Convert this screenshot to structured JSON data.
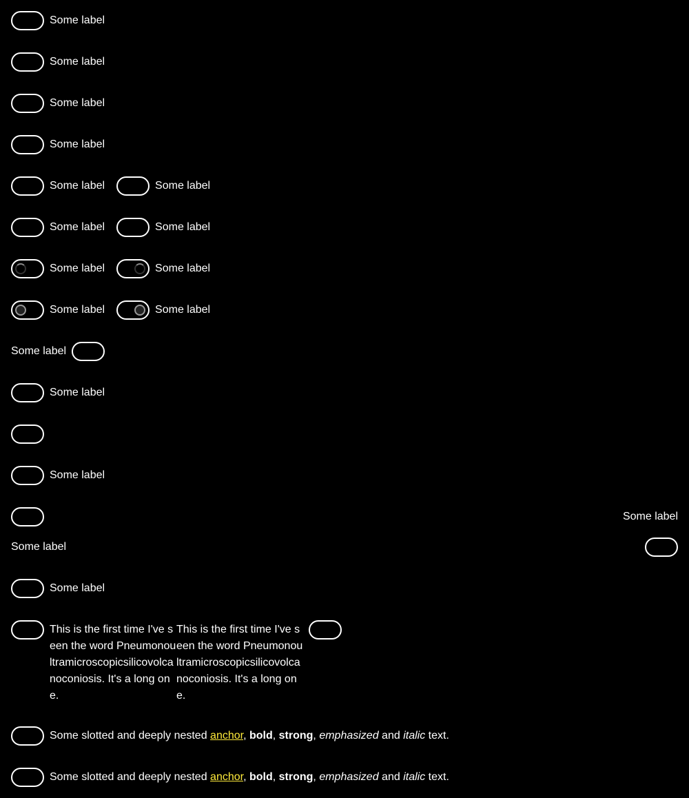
{
  "label": "Some label",
  "long_text": "This is the first time I've seen the word Pneumonoultramicroscopicsilicovolcanoconiosis. It's a long one.",
  "rich": {
    "prefix": "Some slotted and deeply nested ",
    "anchor": "anchor",
    "sep1": ", ",
    "bold": "bold",
    "sep2": ", ",
    "strong": "strong",
    "sep3": ", ",
    "emphasized": "emphasized",
    "and": " and ",
    "italic": "italic",
    "suffix": " text."
  },
  "colors": {
    "background": "#000000",
    "foreground": "#ffffff",
    "anchor": "#ffeb3b"
  }
}
